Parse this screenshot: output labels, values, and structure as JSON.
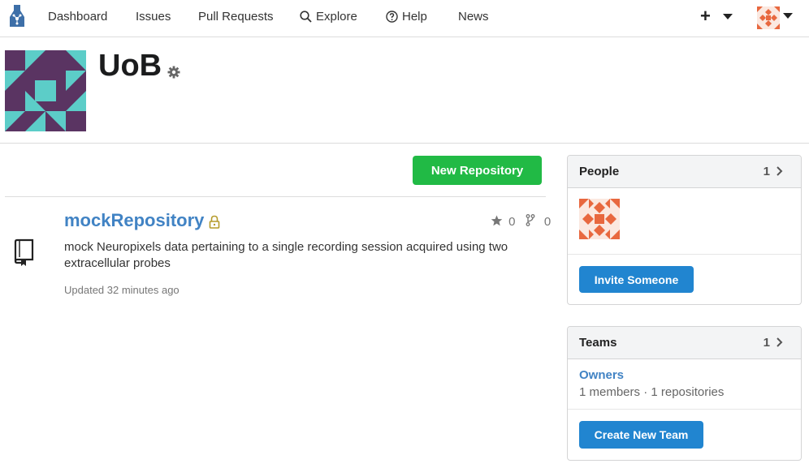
{
  "nav": {
    "items": [
      {
        "label": "Dashboard"
      },
      {
        "label": "Issues"
      },
      {
        "label": "Pull Requests"
      },
      {
        "label": "Explore",
        "icon": "search-icon"
      },
      {
        "label": "Help",
        "icon": "help-circle-icon"
      },
      {
        "label": "News"
      }
    ],
    "create_icon": "plus-icon",
    "user_icon": "user-avatar"
  },
  "org": {
    "name": "UoB",
    "settings_icon": "gear-icon"
  },
  "actions": {
    "new_repo_label": "New Repository"
  },
  "repos": [
    {
      "name": "mockRepository",
      "private": true,
      "stars": "0",
      "forks": "0",
      "description": "mock Neuropixels data pertaining to a single recording session acquired using two extracellular probes",
      "updated": "Updated 32 minutes ago"
    }
  ],
  "people": {
    "title": "People",
    "count": "1",
    "invite_label": "Invite Someone"
  },
  "teams": {
    "title": "Teams",
    "count": "1",
    "items": [
      {
        "name": "Owners",
        "meta": "1 members · 1 repositories"
      }
    ],
    "create_label": "Create New Team"
  },
  "colors": {
    "green": "#21ba45",
    "blue_button": "#2185d0",
    "link": "#4183c4",
    "org_avatar_bg": "#5a3462",
    "org_avatar_accent": "#5ccdc8",
    "user_avatar_accent": "#e8683f"
  }
}
